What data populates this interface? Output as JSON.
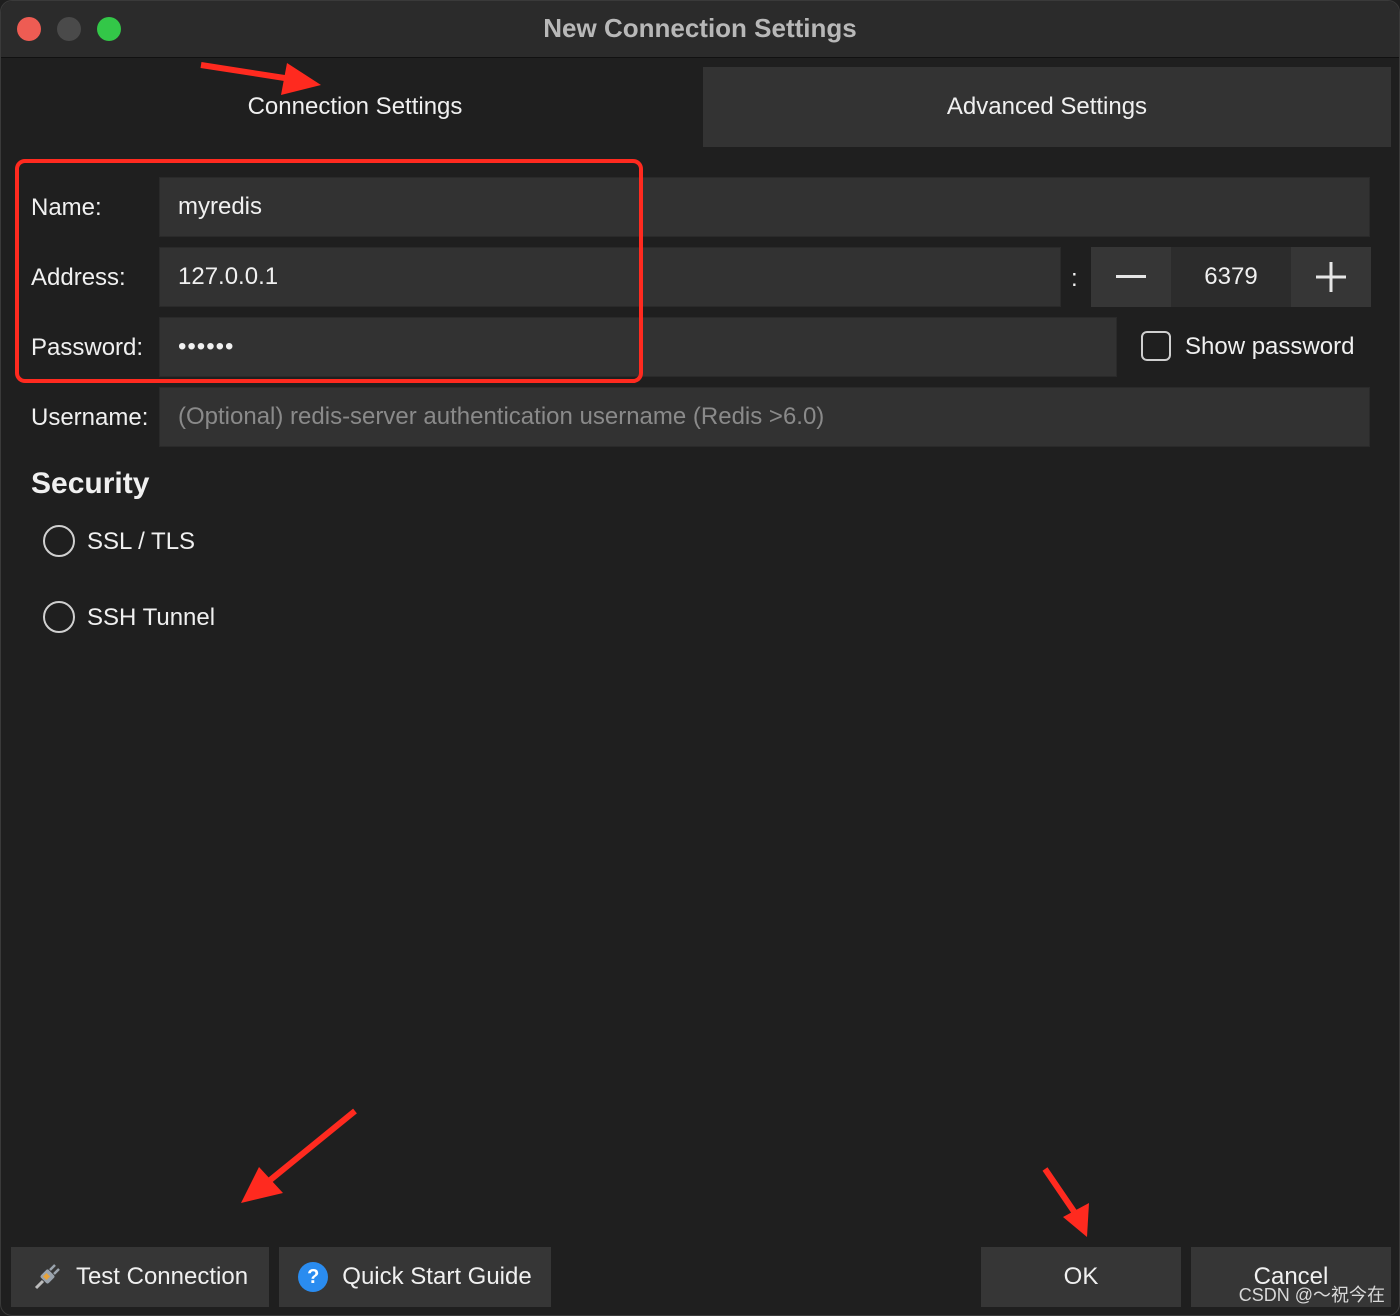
{
  "window": {
    "title": "New Connection Settings"
  },
  "tabs": [
    {
      "label": "Connection Settings",
      "active": true
    },
    {
      "label": "Advanced Settings",
      "active": false
    }
  ],
  "form": {
    "name_label": "Name:",
    "name_value": "myredis",
    "address_label": "Address:",
    "address_value": "127.0.0.1",
    "port_separator": ":",
    "port_value": "6379",
    "password_label": "Password:",
    "password_value": "••••••",
    "show_password_label": "Show password",
    "show_password_checked": false,
    "username_label": "Username:",
    "username_placeholder": "(Optional) redis-server authentication username (Redis >6.0)"
  },
  "security": {
    "heading": "Security",
    "options": [
      {
        "label": "SSL / TLS",
        "selected": false
      },
      {
        "label": "SSH Tunnel",
        "selected": false
      }
    ]
  },
  "buttons": {
    "test_connection": "Test Connection",
    "quick_start": "Quick Start Guide",
    "ok": "OK",
    "cancel": "Cancel"
  },
  "icons": {
    "test_connection": "plug-icon",
    "quick_start": "help-icon",
    "port_decrement": "minus-icon",
    "port_increment": "plus-icon"
  },
  "colors": {
    "annotation": "#ff2a1f",
    "help_icon": "#2a8cf0",
    "close_light": "#ee5c53",
    "max_light": "#33c748"
  },
  "watermark": "CSDN @～祝今在"
}
